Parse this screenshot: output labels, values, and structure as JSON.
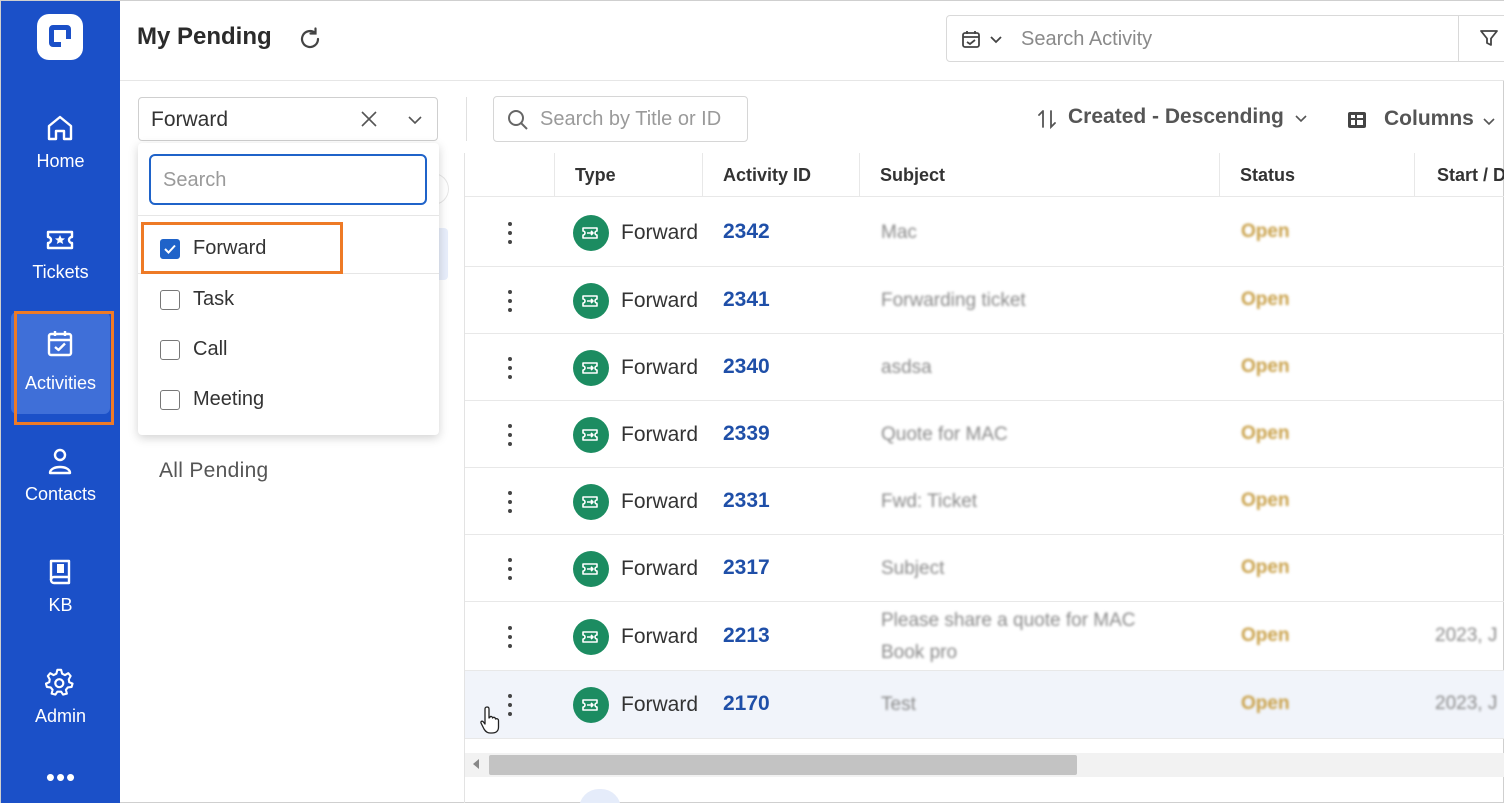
{
  "header": {
    "title": "My Pending",
    "search_placeholder": "Search Activity"
  },
  "sidebar": {
    "items": [
      {
        "label": "Home",
        "icon": "home-icon"
      },
      {
        "label": "Tickets",
        "icon": "ticket-icon"
      },
      {
        "label": "Activities",
        "icon": "calendar-check-icon",
        "active": true
      },
      {
        "label": "Contacts",
        "icon": "person-icon"
      },
      {
        "label": "KB",
        "icon": "book-icon"
      },
      {
        "label": "Admin",
        "icon": "gear-icon"
      }
    ],
    "more": "•••"
  },
  "toolbar": {
    "type_filter_value": "Forward",
    "title_search_placeholder": "Search by Title or ID",
    "sort_label": "Created - Descending",
    "columns_label": "Columns"
  },
  "type_dropdown": {
    "search_placeholder": "Search",
    "options": [
      {
        "label": "Forward",
        "checked": true
      },
      {
        "label": "Task",
        "checked": false
      },
      {
        "label": "Call",
        "checked": false
      },
      {
        "label": "Meeting",
        "checked": false
      }
    ]
  },
  "left_panel": {
    "all_pending": "All Pending"
  },
  "table": {
    "columns": [
      "Type",
      "Activity ID",
      "Subject",
      "Status",
      "Start / D"
    ],
    "rows": [
      {
        "type": "Forward",
        "id": "2342",
        "subject": "Mac",
        "status": "Open",
        "start": ""
      },
      {
        "type": "Forward",
        "id": "2341",
        "subject": "Forwarding ticket",
        "status": "Open",
        "start": ""
      },
      {
        "type": "Forward",
        "id": "2340",
        "subject": "asdsa",
        "status": "Open",
        "start": ""
      },
      {
        "type": "Forward",
        "id": "2339",
        "subject": "Quote for MAC",
        "status": "Open",
        "start": ""
      },
      {
        "type": "Forward",
        "id": "2331",
        "subject": "Fwd: Ticket",
        "status": "Open",
        "start": ""
      },
      {
        "type": "Forward",
        "id": "2317",
        "subject": "Subject",
        "status": "Open",
        "start": ""
      },
      {
        "type": "Forward",
        "id": "2213",
        "subject": "Please share a quote for MAC Book pro",
        "status": "Open",
        "start": "2023, J"
      },
      {
        "type": "Forward",
        "id": "2170",
        "subject": "Test",
        "status": "Open",
        "start": "2023, J"
      }
    ]
  },
  "colors": {
    "sidebar": "#1b50c8",
    "sidebar_active": "#3f6fd8",
    "highlight_outline": "#ee7a26",
    "type_icon": "#1c8c61",
    "link": "#1f4fa8",
    "status_open": "#c9a14a",
    "checkbox": "#1f63c9"
  }
}
